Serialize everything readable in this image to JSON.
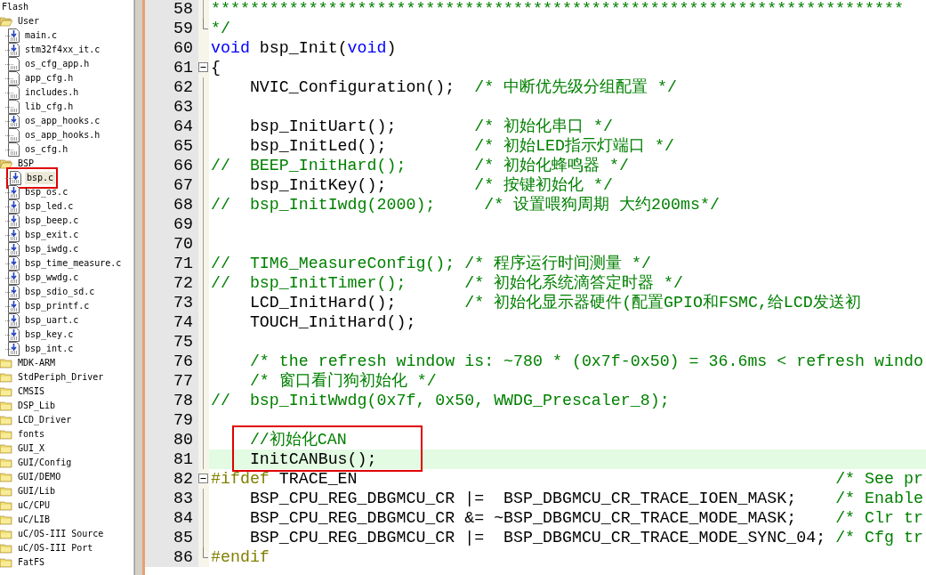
{
  "project_tree": {
    "label": "Flash",
    "selected": false,
    "children": [
      {
        "label": "User",
        "kind": "folder",
        "expanded": true,
        "selected": false,
        "children": [
          {
            "label": "main.c",
            "kind": "source",
            "selected": false
          },
          {
            "label": "stm32f4xx_it.c",
            "kind": "source",
            "selected": false
          },
          {
            "label": "os_cfg_app.h",
            "kind": "header",
            "selected": false
          },
          {
            "label": "app_cfg.h",
            "kind": "header",
            "selected": false
          },
          {
            "label": "includes.h",
            "kind": "header",
            "selected": false
          },
          {
            "label": "lib_cfg.h",
            "kind": "header",
            "selected": false
          },
          {
            "label": "os_app_hooks.c",
            "kind": "source",
            "selected": false
          },
          {
            "label": "os_app_hooks.h",
            "kind": "header",
            "selected": false
          },
          {
            "label": "os_cfg.h",
            "kind": "header",
            "selected": false
          }
        ]
      },
      {
        "label": "BSP",
        "kind": "folder",
        "expanded": true,
        "selected": false,
        "children": [
          {
            "label": "bsp.c",
            "kind": "source",
            "selected": true,
            "marked": true
          },
          {
            "label": "bsp_os.c",
            "kind": "source",
            "selected": false
          },
          {
            "label": "bsp_led.c",
            "kind": "source",
            "selected": false
          },
          {
            "label": "bsp_beep.c",
            "kind": "source",
            "selected": false
          },
          {
            "label": "bsp_exit.c",
            "kind": "source",
            "selected": false
          },
          {
            "label": "bsp_iwdg.c",
            "kind": "source",
            "selected": false
          },
          {
            "label": "bsp_time_measure.c",
            "kind": "source",
            "selected": false
          },
          {
            "label": "bsp_wwdg.c",
            "kind": "source",
            "selected": false
          },
          {
            "label": "bsp_sdio_sd.c",
            "kind": "source",
            "selected": false
          },
          {
            "label": "bsp_printf.c",
            "kind": "source",
            "selected": false
          },
          {
            "label": "bsp_uart.c",
            "kind": "source",
            "selected": false
          },
          {
            "label": "bsp_key.c",
            "kind": "source",
            "selected": false
          },
          {
            "label": "bsp_int.c",
            "kind": "source",
            "selected": false
          }
        ]
      },
      {
        "label": "MDK-ARM",
        "kind": "folder",
        "expanded": false,
        "selected": false
      },
      {
        "label": "StdPeriph_Driver",
        "kind": "folder",
        "expanded": false,
        "selected": false
      },
      {
        "label": "CMSIS",
        "kind": "folder",
        "expanded": false,
        "selected": false
      },
      {
        "label": "DSP_Lib",
        "kind": "folder",
        "expanded": false,
        "selected": false
      },
      {
        "label": "LCD_Driver",
        "kind": "folder",
        "expanded": false,
        "selected": false
      },
      {
        "label": "fonts",
        "kind": "folder",
        "expanded": false,
        "selected": false
      },
      {
        "label": "GUI_X",
        "kind": "folder",
        "expanded": false,
        "selected": false
      },
      {
        "label": "GUI/Config",
        "kind": "folder",
        "expanded": false,
        "selected": false
      },
      {
        "label": "GUI/DEMO",
        "kind": "folder",
        "expanded": false,
        "selected": false
      },
      {
        "label": "GUI/Lib",
        "kind": "folder",
        "expanded": false,
        "selected": false
      },
      {
        "label": "uC/CPU",
        "kind": "folder",
        "expanded": false,
        "selected": false
      },
      {
        "label": "uC/LIB",
        "kind": "folder",
        "expanded": false,
        "selected": false
      },
      {
        "label": "uC/OS-III Source",
        "kind": "folder",
        "expanded": false,
        "selected": false
      },
      {
        "label": "uC/OS-III Port",
        "kind": "folder",
        "expanded": false,
        "selected": false
      },
      {
        "label": "FatFS",
        "kind": "folder",
        "expanded": false,
        "selected": false
      }
    ]
  },
  "editor": {
    "lines": [
      {
        "number": "58",
        "segments": [
          {
            "text": "***********************************************************************",
            "kind": "comment"
          }
        ]
      },
      {
        "number": "59",
        "block_end": true,
        "segments": [
          {
            "text": "*/",
            "kind": "comment"
          }
        ]
      },
      {
        "number": "60",
        "segments": [
          {
            "text": "void",
            "kind": "keyword"
          },
          {
            "text": " bsp_Init(",
            "kind": "code"
          },
          {
            "text": "void",
            "kind": "keyword"
          },
          {
            "text": ")",
            "kind": "code"
          }
        ]
      },
      {
        "number": "61",
        "collapsible": true,
        "segments": [
          {
            "text": "{",
            "kind": "code"
          }
        ]
      },
      {
        "number": "62",
        "segments": [
          {
            "text": "    NVIC_Configuration();  ",
            "kind": "code"
          },
          {
            "text": "/* 中断优先级分组配置 */",
            "kind": "comment"
          }
        ]
      },
      {
        "number": "63"
      },
      {
        "number": "64",
        "segments": [
          {
            "text": "    bsp_InitUart();        ",
            "kind": "code"
          },
          {
            "text": "/* 初始化串口 */",
            "kind": "comment"
          }
        ]
      },
      {
        "number": "65",
        "segments": [
          {
            "text": "    bsp_InitLed();         ",
            "kind": "code"
          },
          {
            "text": "/* 初始LED指示灯端口 */",
            "kind": "comment"
          }
        ]
      },
      {
        "number": "66",
        "segments": [
          {
            "text": "//  BEEP_InitHard();       /* 初始化蜂鸣器 */",
            "kind": "comment"
          }
        ]
      },
      {
        "number": "67",
        "segments": [
          {
            "text": "    bsp_InitKey();         ",
            "kind": "code"
          },
          {
            "text": "/* 按键初始化 */",
            "kind": "comment"
          }
        ]
      },
      {
        "number": "68",
        "segments": [
          {
            "text": "//  bsp_InitIwdg(2000);     /* 设置喂狗周期 大约200ms*/",
            "kind": "comment"
          }
        ]
      },
      {
        "number": "69"
      },
      {
        "number": "70"
      },
      {
        "number": "71",
        "segments": [
          {
            "text": "//  TIM6_MeasureConfig(); /* 程序运行时间测量 */",
            "kind": "comment"
          }
        ]
      },
      {
        "number": "72",
        "segments": [
          {
            "text": "//  bsp_InitTimer();      /* 初始化系统滴答定时器 */",
            "kind": "comment"
          }
        ]
      },
      {
        "number": "73",
        "segments": [
          {
            "text": "    LCD_InitHard();       ",
            "kind": "code"
          },
          {
            "text": "/* 初始化显示器硬件(配置GPIO和FSMC,给LCD发送初",
            "kind": "comment"
          }
        ]
      },
      {
        "number": "74",
        "segments": [
          {
            "text": "    TOUCH_InitHard();",
            "kind": "code"
          }
        ]
      },
      {
        "number": "75"
      },
      {
        "number": "76",
        "segments": [
          {
            "text": "    /* the refresh window is: ~780 * (0x7f-0x50) = 36.6ms < refresh windo",
            "kind": "comment"
          }
        ]
      },
      {
        "number": "77",
        "segments": [
          {
            "text": "    /* 窗口看门狗初始化 */",
            "kind": "comment"
          }
        ]
      },
      {
        "number": "78",
        "segments": [
          {
            "text": "//  bsp_InitWwdg(0x7f, 0x50, WWDG_Prescaler_8);",
            "kind": "comment"
          }
        ]
      },
      {
        "number": "79"
      },
      {
        "number": "80",
        "marked": true,
        "segments": [
          {
            "text": "    //初始化CAN",
            "kind": "comment"
          }
        ]
      },
      {
        "number": "81",
        "marked": true,
        "current": true,
        "segments": [
          {
            "text": "    InitCANBus();",
            "kind": "code"
          }
        ]
      },
      {
        "number": "82",
        "collapsible": true,
        "segments": [
          {
            "text": "#ifdef",
            "kind": "preproc"
          },
          {
            "text": " TRACE_EN                                                 ",
            "kind": "code"
          },
          {
            "text": "/* See pr",
            "kind": "comment"
          }
        ]
      },
      {
        "number": "83",
        "segments": [
          {
            "text": "    BSP_CPU_REG_DBGMCU_CR |=  BSP_DBGMCU_CR_TRACE_IOEN_MASK;    ",
            "kind": "code"
          },
          {
            "text": "/* Enable",
            "kind": "comment"
          }
        ]
      },
      {
        "number": "84",
        "segments": [
          {
            "text": "    BSP_CPU_REG_DBGMCU_CR &= ~BSP_DBGMCU_CR_TRACE_MODE_MASK;    ",
            "kind": "code"
          },
          {
            "text": "/* Clr tr",
            "kind": "comment"
          }
        ]
      },
      {
        "number": "85",
        "segments": [
          {
            "text": "    BSP_CPU_REG_DBGMCU_CR |=  BSP_DBGMCU_CR_TRACE_MODE_SYNC_04; ",
            "kind": "code"
          },
          {
            "text": "/* Cfg tr",
            "kind": "comment"
          }
        ]
      },
      {
        "number": "86",
        "block_end": true,
        "segments": [
          {
            "text": "#endif",
            "kind": "preproc"
          }
        ]
      }
    ]
  }
}
